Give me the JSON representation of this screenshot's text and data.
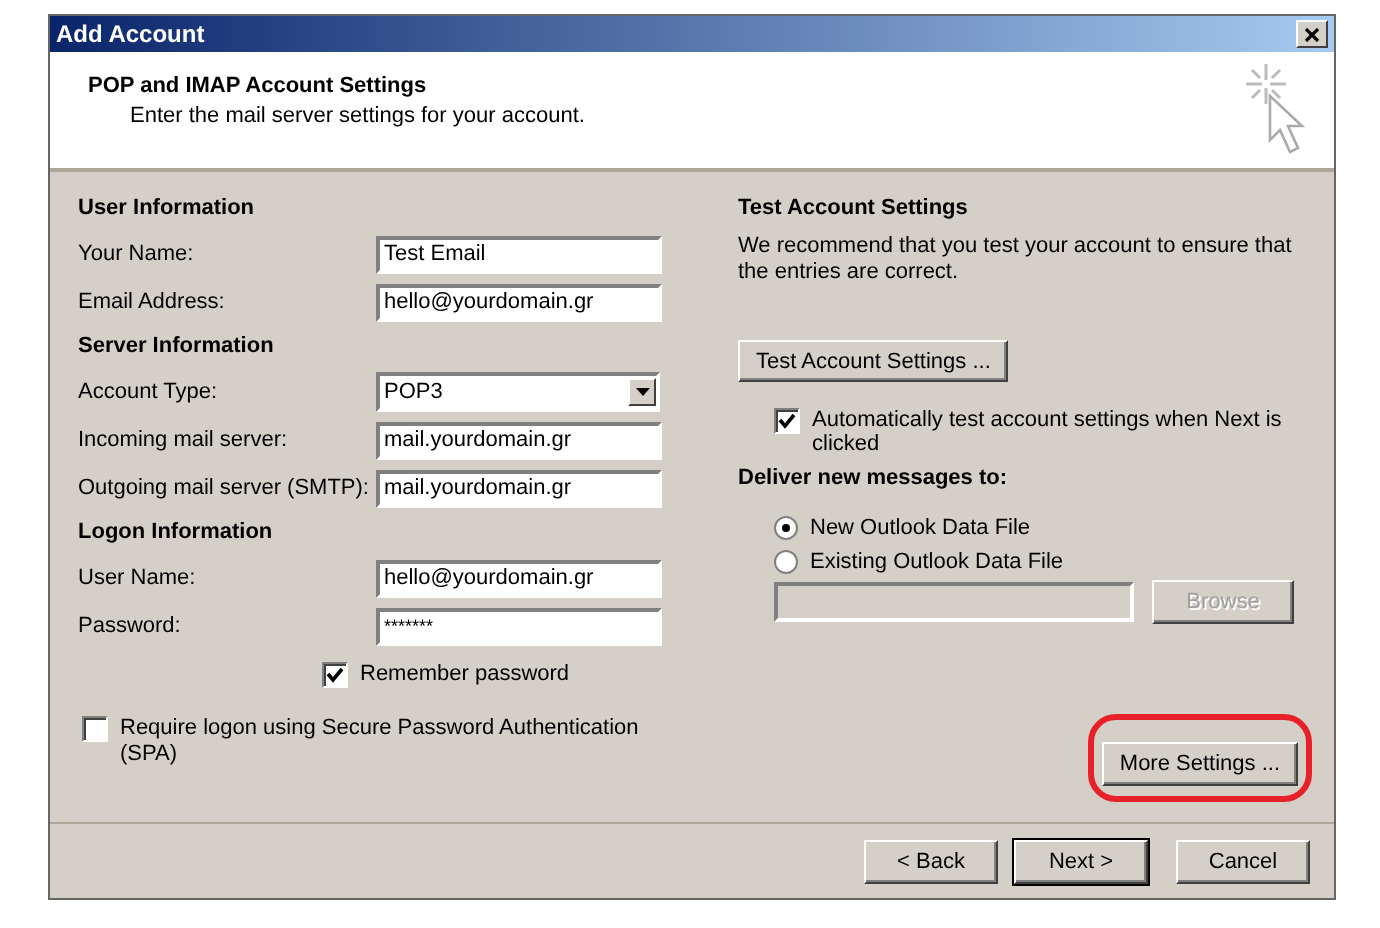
{
  "window": {
    "title": "Add Account"
  },
  "header": {
    "title": "POP and IMAP Account Settings",
    "subtitle": "Enter the mail server settings for your account."
  },
  "left": {
    "sections": [
      {
        "heading": "User Information",
        "fields": [
          {
            "label": "Your Name:",
            "value": "Test Email",
            "kind": "text"
          },
          {
            "label": "Email Address:",
            "value": "hello@yourdomain.gr",
            "kind": "text"
          }
        ]
      },
      {
        "heading": "Server Information",
        "fields": [
          {
            "label": "Account Type:",
            "value": "POP3",
            "kind": "dropdown"
          },
          {
            "label": "Incoming mail server:",
            "value": "mail.yourdomain.gr",
            "kind": "text"
          },
          {
            "label": "Outgoing mail server (SMTP):",
            "value": "mail.yourdomain.gr",
            "kind": "text"
          }
        ]
      },
      {
        "heading": "Logon Information",
        "fields": [
          {
            "label": "User Name:",
            "value": "hello@yourdomain.gr",
            "kind": "text"
          },
          {
            "label": "Password:",
            "value": "*******",
            "kind": "password"
          }
        ]
      }
    ],
    "remember_password": {
      "label": "Remember password",
      "checked": true
    },
    "spa": {
      "label": "Require logon using Secure Password Authentication (SPA)",
      "checked": false
    }
  },
  "right": {
    "heading": "Test Account Settings",
    "description": "We recommend that you test your account to ensure that the entries are correct.",
    "test_button": "Test Account Settings ...",
    "auto_test": {
      "label": "Automatically test account settings when Next is clicked",
      "checked": true
    },
    "deliver_heading": "Deliver new messages to:",
    "deliver_options": [
      {
        "label": "New Outlook Data File",
        "selected": true
      },
      {
        "label": "Existing Outlook Data File",
        "selected": false
      }
    ],
    "file_path": {
      "disabled": true
    },
    "browse": {
      "label": "Browse",
      "disabled": true
    },
    "more_settings": {
      "label": "More Settings ...",
      "highlighted": true
    }
  },
  "footer_buttons": [
    {
      "label": "< Back",
      "default": false
    },
    {
      "label": "Next >",
      "default": true
    },
    {
      "label": "Cancel",
      "default": false
    }
  ]
}
